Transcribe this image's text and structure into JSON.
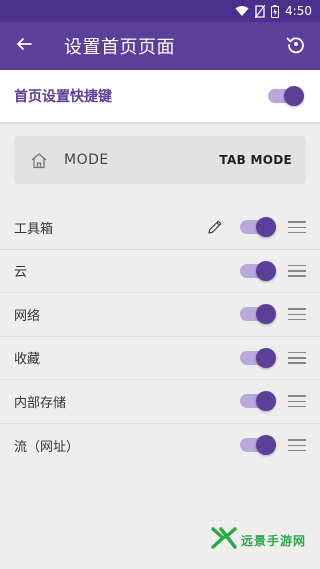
{
  "status_bar": {
    "time": "4:50",
    "icons": [
      "wifi-icon",
      "no-sim-icon",
      "battery-icon"
    ]
  },
  "app_bar": {
    "title": "设置首页页面",
    "back_icon": "arrow-left-icon",
    "reset_icon": "restore-icon"
  },
  "shortcut": {
    "label": "首页设置快捷键",
    "enabled": true
  },
  "mode": {
    "icon": "home-icon",
    "label": "MODE",
    "value": "TAB MODE"
  },
  "items": [
    {
      "label": "工具箱",
      "enabled": true,
      "editable": true
    },
    {
      "label": "云",
      "enabled": true,
      "editable": false
    },
    {
      "label": "网络",
      "enabled": true,
      "editable": false
    },
    {
      "label": "收藏",
      "enabled": true,
      "editable": false
    },
    {
      "label": "内部存储",
      "enabled": true,
      "editable": false
    },
    {
      "label": "流（网址）",
      "enabled": true,
      "editable": false
    }
  ],
  "colors": {
    "primary": "#5b3f99",
    "status_bar": "#4b2f8c",
    "toggle_track": "#b9a8dc",
    "background": "#eeeeee"
  },
  "watermark": {
    "text": "远景手游网"
  }
}
